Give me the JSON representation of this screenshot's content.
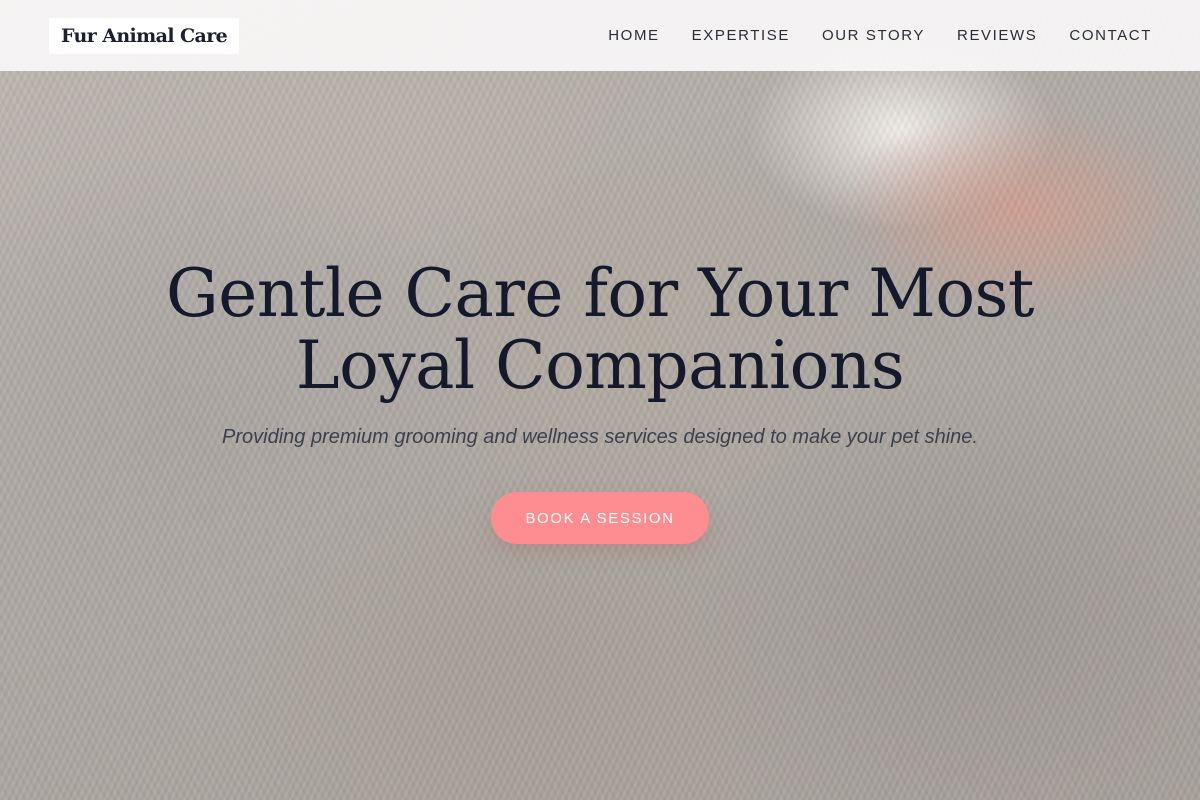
{
  "brand": {
    "logo_text": "Fur Animal Care"
  },
  "nav": {
    "items": [
      {
        "label": "HOME"
      },
      {
        "label": "EXPERTISE"
      },
      {
        "label": "OUR STORY"
      },
      {
        "label": "REVIEWS"
      },
      {
        "label": "CONTACT"
      }
    ]
  },
  "hero": {
    "title": "Gentle Care for Your Most Loyal Companions",
    "subtitle": "Providing premium grooming and wellness services designed to make your pet shine.",
    "cta_label": "BOOK A SESSION",
    "background_image": "cats-snuggling-photo"
  },
  "colors": {
    "cta": "#fd8d90",
    "title": "#141a2c",
    "header_bg": "#f8f7f6"
  }
}
